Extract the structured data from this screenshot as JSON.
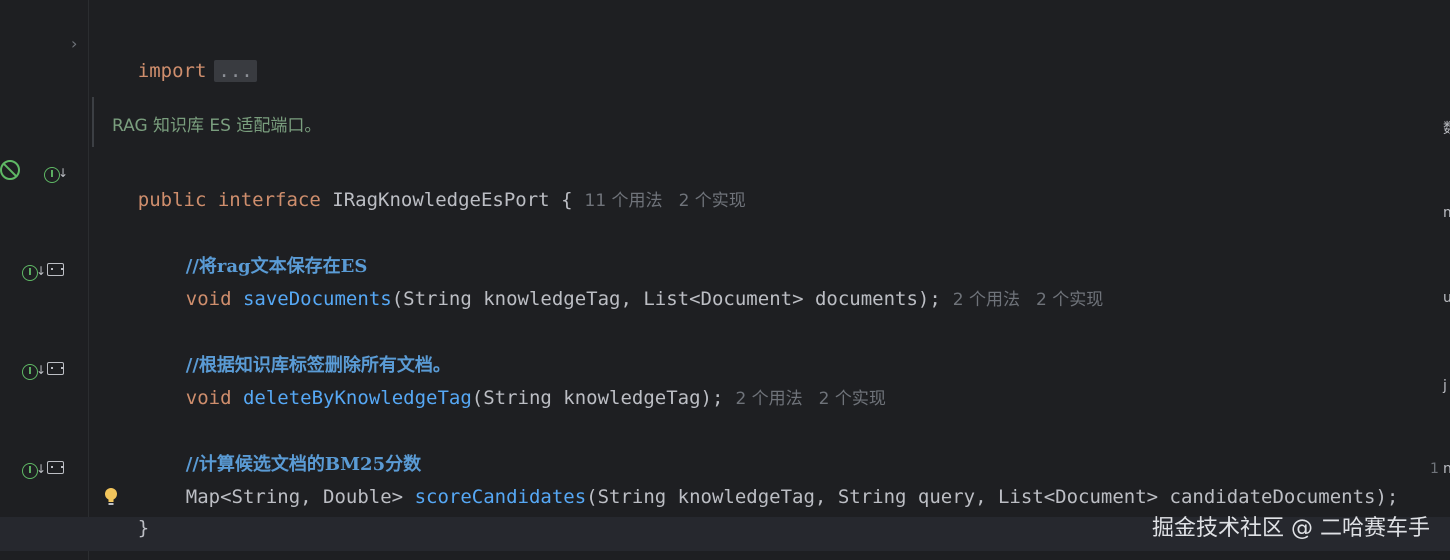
{
  "code": {
    "import_keyword": "import",
    "import_folded": "...",
    "doc_comment": "RAG 知识库 ES 适配端口。",
    "interface_line": {
      "public": "public",
      "interface": "interface",
      "name": "IRagKnowledgeEsPort",
      "brace": "{",
      "usages": "11 个用法",
      "impls": "2 个实现"
    },
    "methods": [
      {
        "comment": "//将rag文本保存在ES",
        "return_type": "void",
        "name": "saveDocuments",
        "params": "(String knowledgeTag, List<Document> documents);",
        "usages": "2 个用法",
        "impls": "2 个实现"
      },
      {
        "comment": "//根据知识库标签删除所有文档。",
        "return_type": "void",
        "name": "deleteByKnowledgeTag",
        "params": "(String knowledgeTag);",
        "usages": "2 个用法",
        "impls": "2 个实现"
      },
      {
        "comment": "//计算候选文档的BM25分数",
        "return_type": "Map<String, Double>",
        "name": "scoreCandidates",
        "params": "(String knowledgeTag, String query, List<Document> candidateDocuments);",
        "tail": "1"
      }
    ],
    "closing_brace": "}"
  },
  "watermark": "掘金技术社区 @ 二哈赛车手",
  "right_edge_fragments": [
    "数",
    "m",
    "u",
    "j",
    "n"
  ],
  "colors": {
    "background": "#1e1f22",
    "keyword": "#cf8e6d",
    "function": "#56a8f5",
    "comment": "#5a9bd5",
    "hint": "#6f737a",
    "gutter_icon": "#5fb865"
  },
  "icons": {
    "fold": "chevron-right-icon",
    "implemented": "implemented-interface-icon",
    "method_impl": "method-implementation-icon",
    "no_entry": "no-entry-icon",
    "bulb": "lightbulb-icon"
  }
}
